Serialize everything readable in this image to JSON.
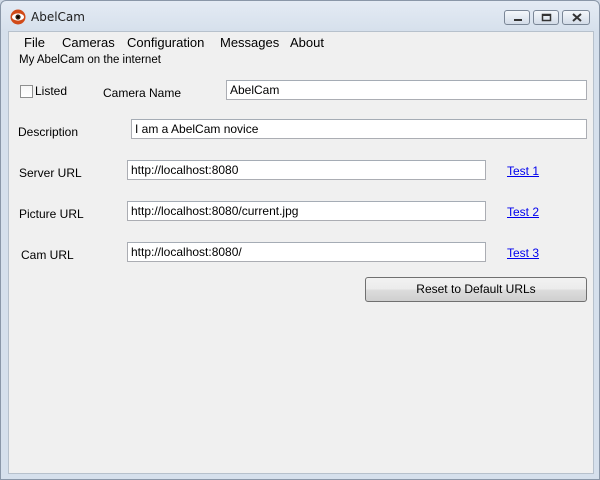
{
  "window": {
    "title": "AbelCam",
    "icon": "eye-icon",
    "controls": [
      "minimize-icon",
      "maximize-icon",
      "close-icon"
    ]
  },
  "menu": {
    "items": [
      "File",
      "Cameras",
      "Configuration",
      "Messages",
      "About"
    ]
  },
  "group": {
    "title": "My AbelCam on the internet"
  },
  "form": {
    "listed_label": "Listed",
    "listed_checked": false,
    "camera_name_label": "Camera Name",
    "camera_name_value": "AbelCam",
    "description_label": "Description",
    "description_value": "I am a AbelCam novice",
    "server_url_label": "Server URL",
    "server_url_value": "http://localhost:8080",
    "server_test_link": "Test 1",
    "picture_url_label": "Picture URL",
    "picture_url_value": "http://localhost:8080/current.jpg",
    "picture_test_link": "Test 2",
    "cam_url_label": "Cam URL",
    "cam_url_value": "http://localhost:8080/",
    "cam_test_link": "Test 3",
    "reset_button": "Reset to Default URLs"
  },
  "colors": {
    "link": "#0000ee",
    "window_bg": "#f0f0f0"
  }
}
